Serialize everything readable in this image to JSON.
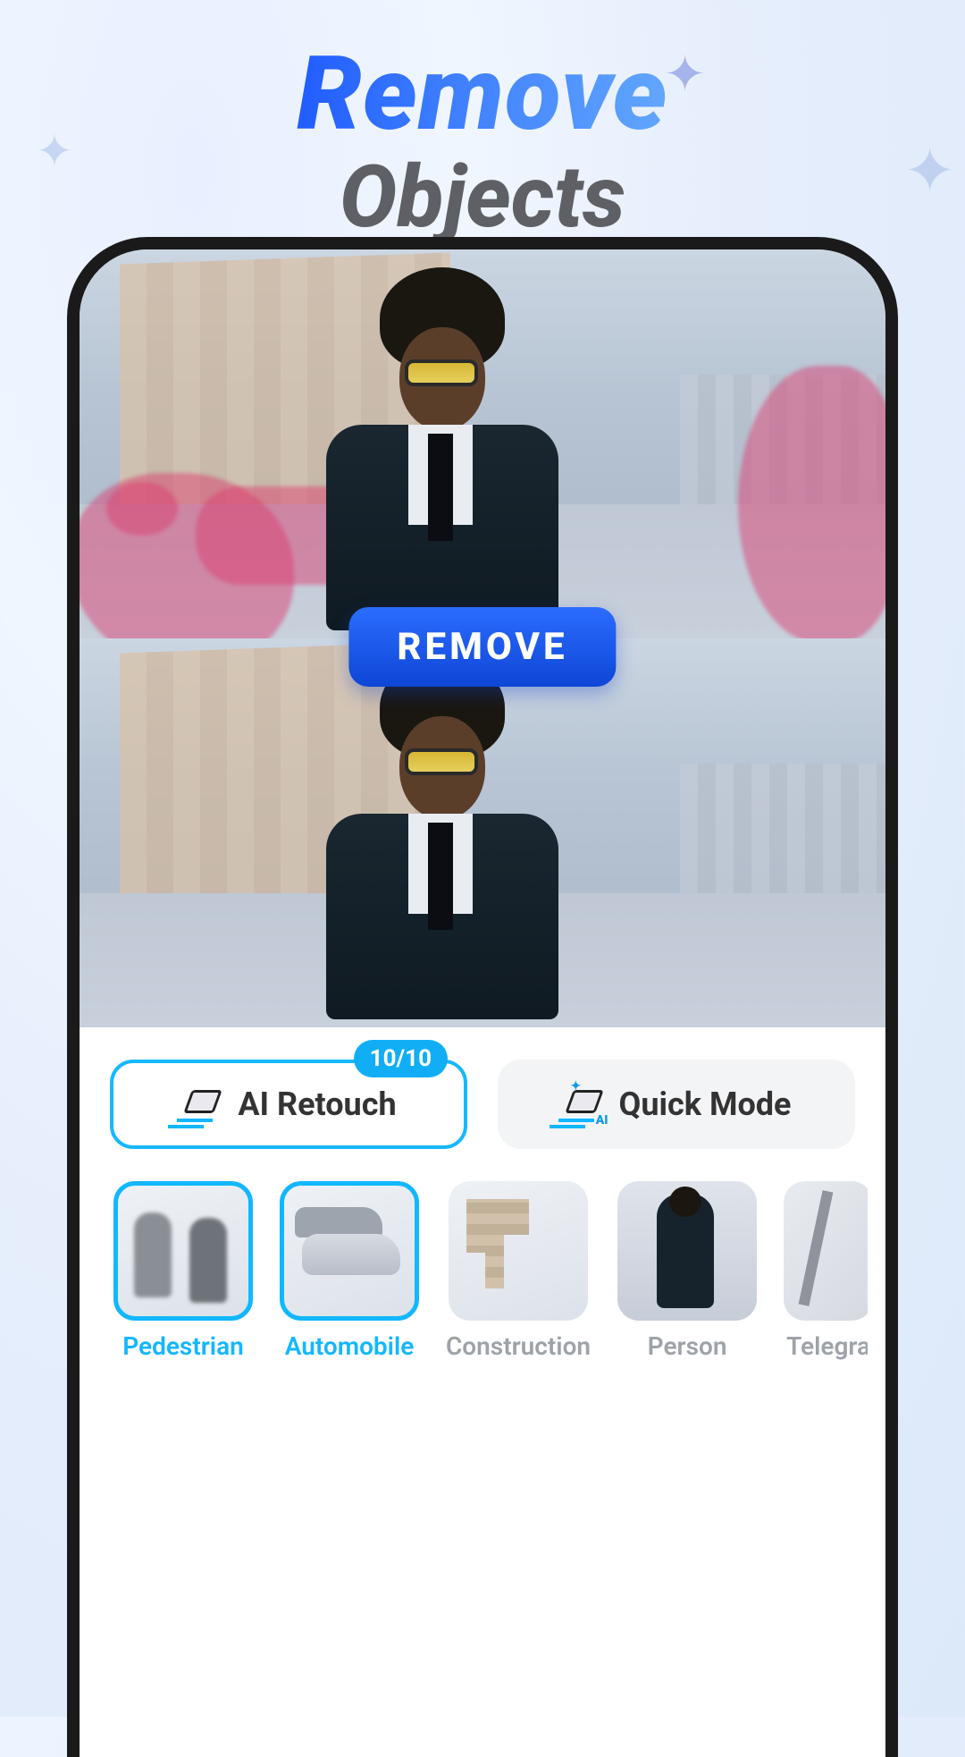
{
  "header": {
    "title_main": "Remove",
    "title_sub": "Objects"
  },
  "action_button": {
    "label": "REMOVE"
  },
  "modes": {
    "ai_retouch": {
      "label": "AI Retouch",
      "badge": "10/10"
    },
    "quick_mode": {
      "label": "Quick Mode"
    }
  },
  "categories": [
    {
      "id": "pedestrian",
      "label": "Pedestrian",
      "selected": true
    },
    {
      "id": "automobile",
      "label": "Automobile",
      "selected": true
    },
    {
      "id": "construction",
      "label": "Construction",
      "selected": false
    },
    {
      "id": "person",
      "label": "Person",
      "selected": false
    },
    {
      "id": "telegraph",
      "label": "Telegra",
      "selected": false
    }
  ]
}
